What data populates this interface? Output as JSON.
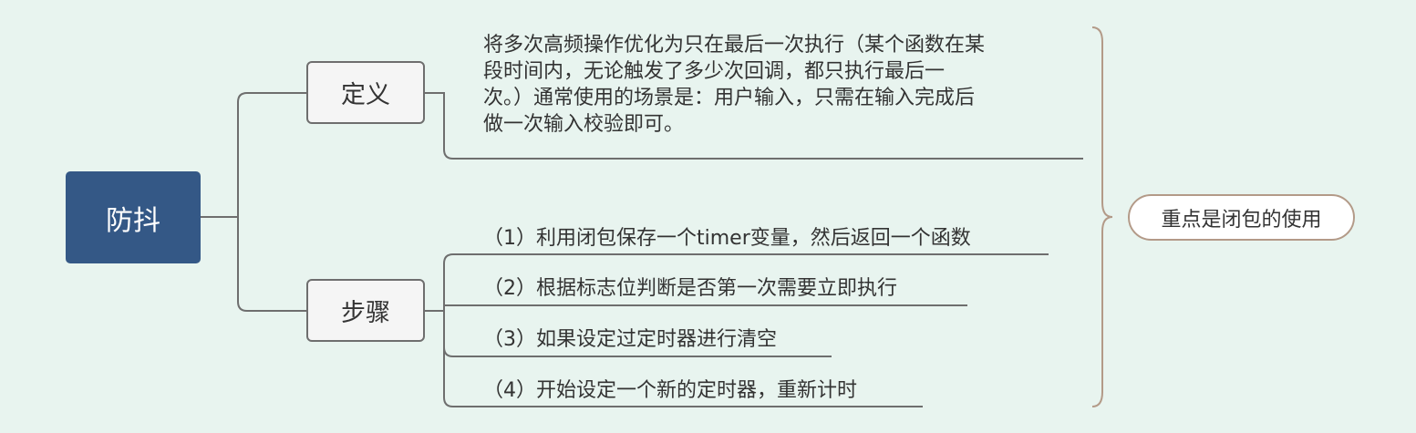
{
  "mindmap": {
    "root": {
      "label": "防抖"
    },
    "branches": [
      {
        "label": "定义",
        "text_lines": [
          "将多次高频操作优化为只在最后一次执行（某个函数在某",
          "段时间内，无论触发了多少次回调，都只执行最后一",
          "次。）通常使用的场景是：用户输入，只需在输入完成后",
          "做一次输入校验即可。"
        ]
      },
      {
        "label": "步骤",
        "steps": [
          "（1）利用闭包保存一个timer变量，然后返回一个函数",
          "（2）根据标志位判断是否第一次需要立即执行",
          "（3）如果设定过定时器进行清空",
          "（4）开始设定一个新的定时器，重新计时"
        ]
      }
    ],
    "summary": {
      "label": "重点是闭包的使用"
    }
  },
  "colors": {
    "background": "#e8f4ef",
    "root_fill": "#345886",
    "connector": "#6e6e6e",
    "brace": "#b39a88"
  }
}
